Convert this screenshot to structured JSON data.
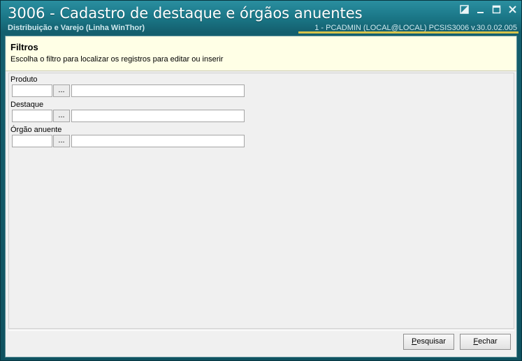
{
  "window": {
    "title": "3006 - Cadastro de destaque e órgãos anuentes",
    "subtitle": "Distribuição e Varejo (Linha WinThor)",
    "session_info": "1 - PCADMIN (LOCAL@LOCAL)   PCSIS3006  v.30.0.02.005",
    "colors": {
      "title_bar": "#1a7686",
      "info_accent": "#d7c34a",
      "header_bg": "#ffffe6"
    }
  },
  "filters": {
    "title": "Filtros",
    "description": "Escolha o filtro para localizar os registros para editar ou inserir",
    "fields": [
      {
        "label": "Produto",
        "code_value": "",
        "browse_label": "...",
        "description_value": ""
      },
      {
        "label": "Destaque",
        "code_value": "",
        "browse_label": "...",
        "description_value": ""
      },
      {
        "label": "Órgão anuente",
        "code_value": "",
        "browse_label": "...",
        "description_value": ""
      }
    ]
  },
  "buttons": {
    "search": {
      "hotkey": "P",
      "rest": "esquisar"
    },
    "close": {
      "hotkey": "F",
      "rest": "echar"
    }
  }
}
